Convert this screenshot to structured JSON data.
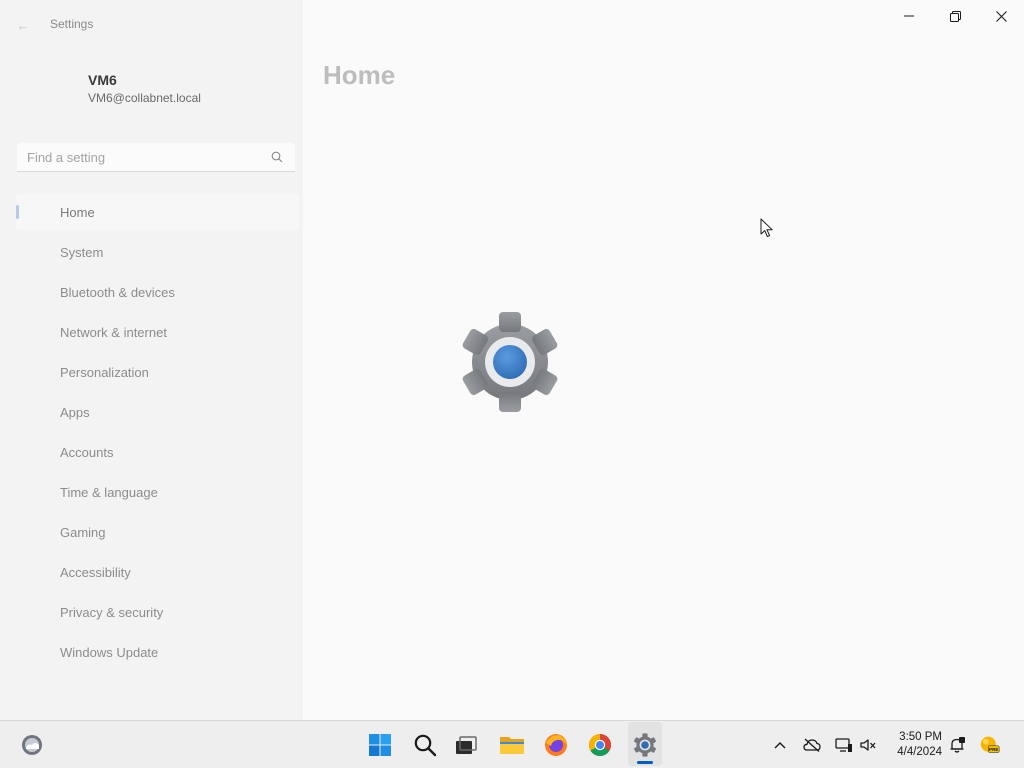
{
  "window": {
    "app_title": "Settings",
    "page_title": "Home"
  },
  "account": {
    "name": "VM6",
    "email": "VM6@collabnet.local"
  },
  "search": {
    "placeholder": "Find a setting",
    "value": ""
  },
  "nav": {
    "selected": "Home",
    "items": [
      {
        "label": "Home"
      },
      {
        "label": "System"
      },
      {
        "label": "Bluetooth & devices"
      },
      {
        "label": "Network & internet"
      },
      {
        "label": "Personalization"
      },
      {
        "label": "Apps"
      },
      {
        "label": "Accounts"
      },
      {
        "label": "Time & language"
      },
      {
        "label": "Gaming"
      },
      {
        "label": "Accessibility"
      },
      {
        "label": "Privacy & security"
      },
      {
        "label": "Windows Update"
      }
    ]
  },
  "taskbar": {
    "pinned": [
      "start-icon",
      "search-icon",
      "task-view-icon",
      "file-explorer-icon",
      "firefox-icon",
      "chrome-icon",
      "settings-icon"
    ],
    "active_app": "settings-icon",
    "tray": [
      "chevron-up-icon",
      "onedrive-offline-icon",
      "network-display-icon",
      "volume-muted-icon",
      "notification-icon",
      "copilot-pre-icon"
    ],
    "clock_time": "3:50 PM",
    "clock_date": "4/4/2024"
  },
  "colors": {
    "accent": "#005fb8",
    "gear_gray": "#8a8d91",
    "gear_blue": "#3d7dc8",
    "window_bg": "#f3f3f3"
  }
}
